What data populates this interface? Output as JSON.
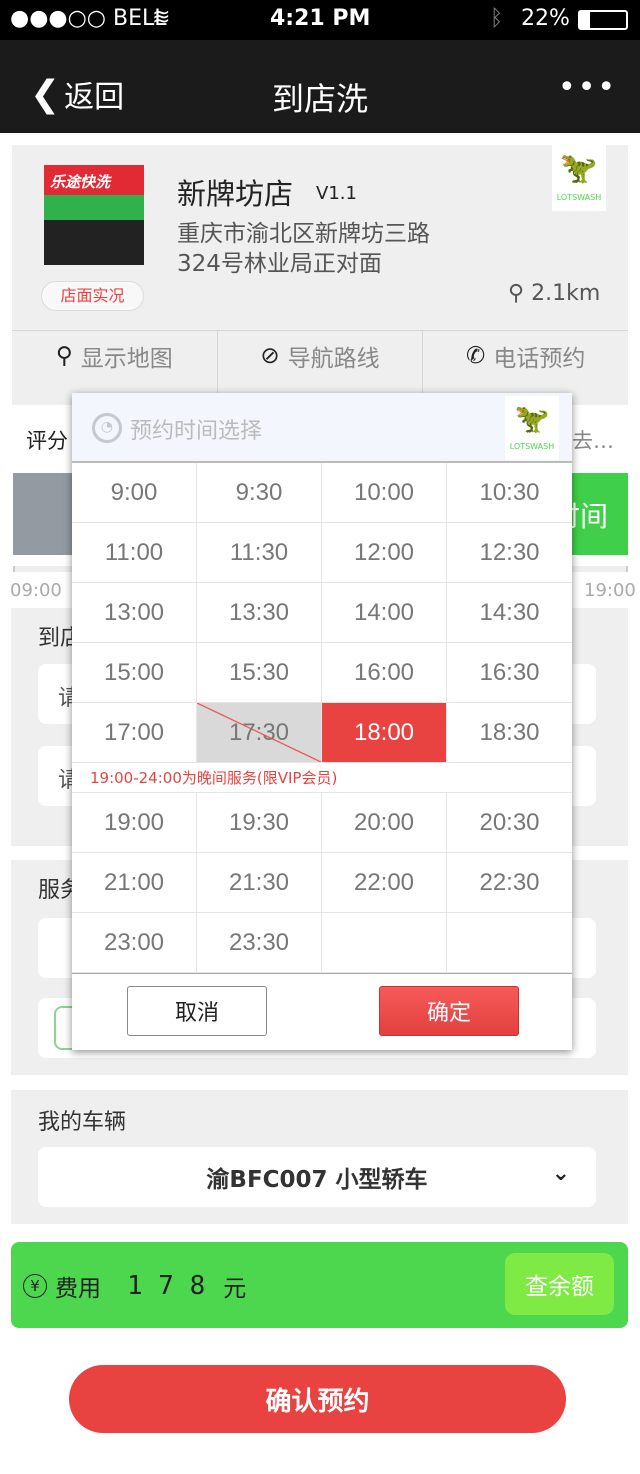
{
  "status_bar": {
    "carrier": "●●●○○ BELL",
    "time": "4:21 PM",
    "battery": "22%"
  },
  "nav": {
    "back": "返回",
    "title": "到店洗",
    "more": "•••"
  },
  "store": {
    "name": "新牌坊店",
    "version": "V1.1",
    "address_line1": "重庆市渝北区新牌坊三路",
    "address_line2": "324号林业局正对面",
    "photo_badge": "店面实况",
    "distance": "2.1km",
    "logo_text": "LOTSWASH",
    "sign_text": "乐途快洗"
  },
  "actions": [
    {
      "label": "显示地图",
      "icon": "map-pin-icon"
    },
    {
      "label": "导航路线",
      "icon": "compass-icon"
    },
    {
      "label": "电话预约",
      "icon": "phone-icon"
    }
  ],
  "background": {
    "rating_label": "评分",
    "rating_right": "去…",
    "time_button": "时间",
    "timeline_start": "09:00",
    "timeline_end": "19:00",
    "section_store": "到店",
    "select_hint": "请",
    "section_service": "服务"
  },
  "modal": {
    "title": "预约时间选择",
    "logo_text": "LOTSWASH",
    "slots_day": [
      "9:00",
      "9:30",
      "10:00",
      "10:30",
      "11:00",
      "11:30",
      "12:00",
      "12:30",
      "13:00",
      "13:30",
      "14:00",
      "14:30",
      "15:00",
      "15:30",
      "16:00",
      "16:30",
      "17:00",
      "17:30",
      "18:00",
      "18:30"
    ],
    "unavailable": "17:30",
    "selected": "18:00",
    "night_note": "19:00-24:00为晚间服务(限VIP会员)",
    "slots_night": [
      "19:00",
      "19:30",
      "20:00",
      "20:30",
      "21:00",
      "21:30",
      "22:00",
      "22:30",
      "23:00",
      "23:30"
    ],
    "cancel": "取消",
    "confirm": "确定"
  },
  "vehicle": {
    "label": "我的车辆",
    "value": "渝BFC007 小型轿车"
  },
  "fee": {
    "label": "费用",
    "amount": "1 7 8",
    "unit": "元",
    "balance_button": "查余额"
  },
  "submit": "确认预约",
  "colors": {
    "accent_red": "#e84340",
    "green": "#4cd74f",
    "light_green": "#7eea43"
  }
}
